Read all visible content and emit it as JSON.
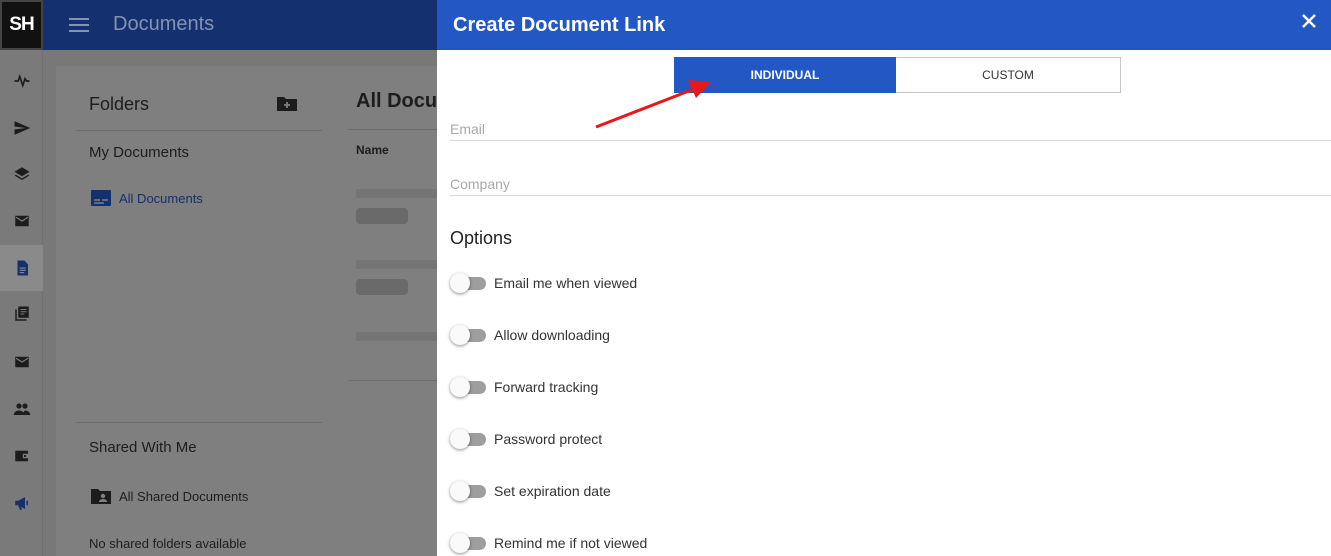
{
  "app": {
    "logo_text": "SH",
    "appbar_title": "Documents"
  },
  "rail": {
    "items": [
      {
        "icon": "activity-icon"
      },
      {
        "icon": "send-icon"
      },
      {
        "icon": "layers-icon"
      },
      {
        "icon": "mail-icon"
      },
      {
        "icon": "document-icon",
        "active": true
      },
      {
        "icon": "library-icon"
      },
      {
        "icon": "mail-icon"
      },
      {
        "icon": "people-icon"
      },
      {
        "icon": "wallet-icon"
      },
      {
        "icon": "megaphone-icon"
      }
    ]
  },
  "sidebar": {
    "folders_title": "Folders",
    "my_documents": "My Documents",
    "all_documents": "All Documents",
    "shared_with_me": "Shared With Me",
    "all_shared_documents": "All Shared Documents",
    "no_shared": "No shared folders available"
  },
  "main": {
    "title": "All Docu",
    "name_column": "Name"
  },
  "dialog": {
    "title": "Create Document Link",
    "tabs": {
      "individual": "INDIVIDUAL",
      "custom": "CUSTOM"
    },
    "email_placeholder": "Email",
    "company_placeholder": "Company",
    "options_title": "Options",
    "options": [
      {
        "label": "Email me when viewed",
        "on": false
      },
      {
        "label": "Allow downloading",
        "on": false
      },
      {
        "label": "Forward tracking",
        "on": false
      },
      {
        "label": "Password protect",
        "on": false
      },
      {
        "label": "Set expiration date",
        "on": false
      },
      {
        "label": "Remind me if not viewed",
        "on": false
      }
    ]
  },
  "colors": {
    "primary": "#2358c4",
    "appbar": "#14306e",
    "annotation": "#e8191b"
  }
}
